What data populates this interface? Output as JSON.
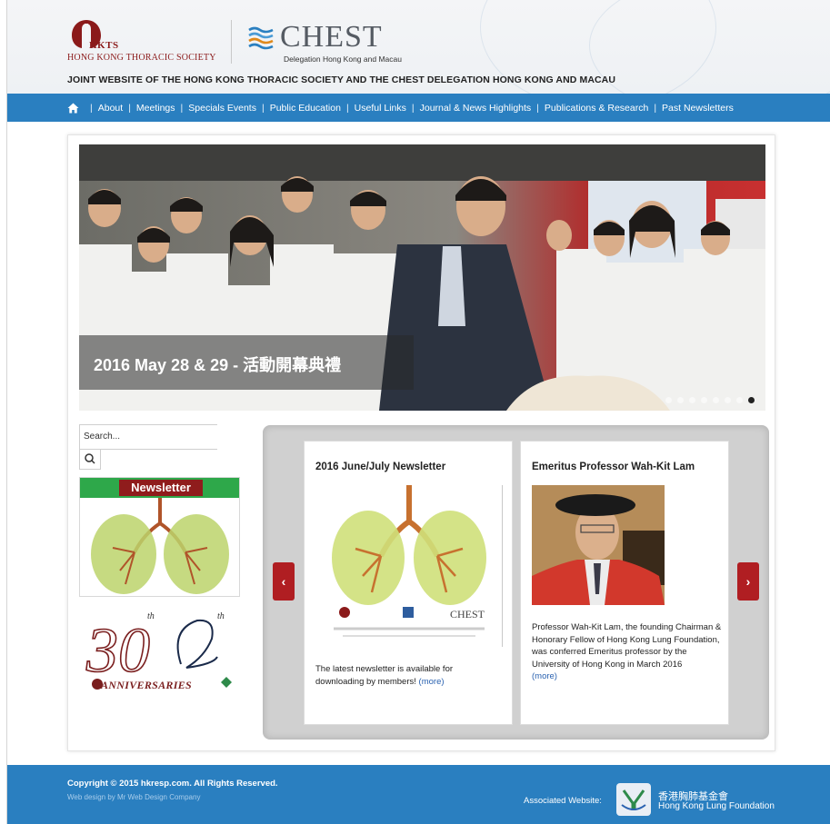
{
  "header": {
    "hkts_abbr": "HKTS",
    "hkts_name": "HONG KONG THORACIC SOCIETY",
    "chest_word": "CHEST",
    "chest_sub": "Delegation Hong Kong and Macau",
    "joint_title": "JOINT WEBSITE OF THE HONG KONG THORACIC SOCIETY AND THE CHEST DELEGATION HONG KONG AND MACAU"
  },
  "nav": {
    "items": [
      "About",
      "Meetings",
      "Specials Events",
      "Public Education",
      "Useful Links",
      "Journal & News Highlights",
      "Publications & Research",
      "Past Newsletters"
    ],
    "separator": "|"
  },
  "slider": {
    "caption": "2016 May 28 & 29 - 活動開幕典禮",
    "dot_count": 8,
    "active_dot": 8
  },
  "sidebar": {
    "search_placeholder": "Search...",
    "newsletter_label": "Newsletter",
    "anniv_30": "30",
    "anniv_th": "th",
    "anniv_text": "ANNIVERSARIES"
  },
  "carousel": {
    "prev": "‹",
    "next": "›",
    "cards": [
      {
        "title": "2016 June/July Newsletter",
        "text": "The latest newsletter is available for downloading by members!",
        "more": "(more)",
        "image_chest": "CHEST"
      },
      {
        "title": "Emeritus Professor Wah-Kit Lam",
        "text": "Professor Wah-Kit Lam, the founding Chairman & Honorary Fellow of Hong Kong Lung Foundation, was conferred Emeritus professor by the University of Hong Kong in March 2016",
        "more": "(more)"
      }
    ]
  },
  "footer": {
    "copyright": "Copyright © 2015 hkresp.com. All Rights Reserved.",
    "credit": "Web design by Mr Web Design Company",
    "assoc_label": "Associated Website:",
    "hklf_cn": "香港胸肺基金會",
    "hklf_en": "Hong Kong Lung Foundation"
  },
  "colors": {
    "nav_blue": "#2a7fc0",
    "brand_red": "#8b1a1a",
    "arrow_red": "#b01e22",
    "link_blue": "#2a62b0"
  }
}
